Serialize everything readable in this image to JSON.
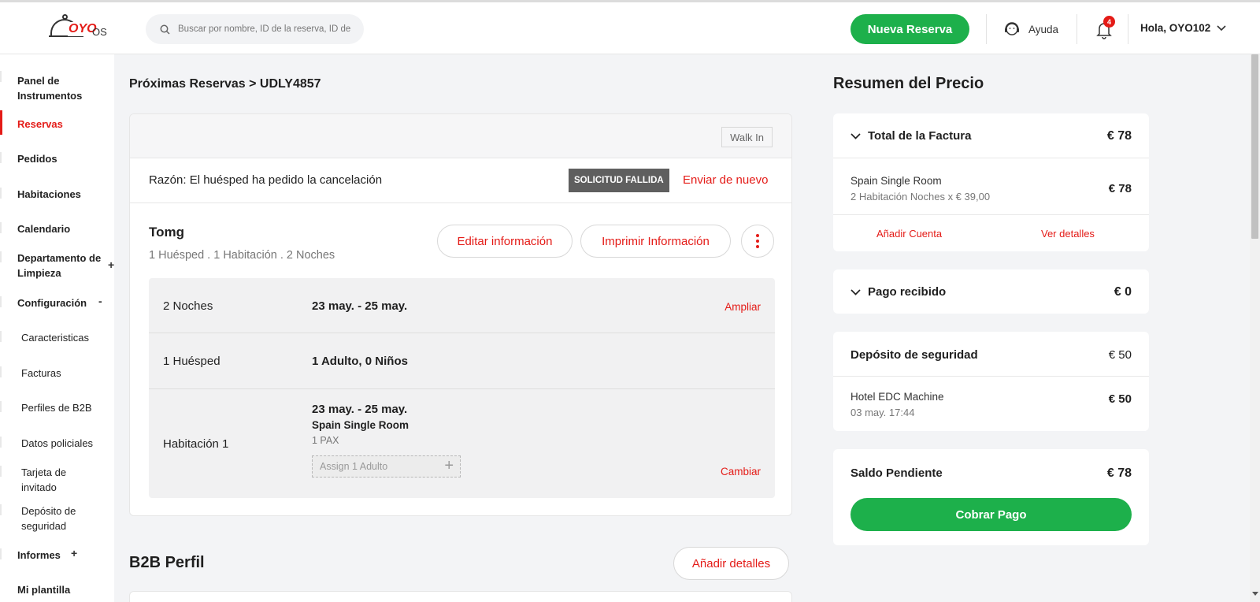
{
  "header": {
    "logo_brand": "OYO",
    "logo_suffix": "OS",
    "search_placeholder": "Buscar por nombre, ID de la reserva, ID de",
    "new_booking_label": "Nueva Reserva",
    "help_label": "Ayuda",
    "notification_count": "4",
    "user_greeting": "Hola, OYO102"
  },
  "sidebar": {
    "items": [
      {
        "label": "Panel de Instrumentos"
      },
      {
        "label": "Reservas"
      },
      {
        "label": "Pedidos"
      },
      {
        "label": "Habitaciones"
      },
      {
        "label": "Calendario"
      },
      {
        "label": "Departamento de Limpieza",
        "sign": "+"
      },
      {
        "label": "Configuración",
        "sign": "-"
      },
      {
        "label": "Caracteristicas"
      },
      {
        "label": "Facturas"
      },
      {
        "label": "Perfiles de B2B"
      },
      {
        "label": "Datos policiales"
      },
      {
        "label": "Tarjeta de invitado"
      },
      {
        "label": "Depósito de seguridad"
      },
      {
        "label": "Informes",
        "sign": "+"
      },
      {
        "label": "Mi plantilla"
      }
    ]
  },
  "main": {
    "breadcrumb": "Próximas Reservas > UDLY4857",
    "walk_in": "Walk In",
    "reason": "Razón: El huésped ha pedido la cancelación",
    "failed_badge": "SOLICITUD FALLIDA",
    "resend_link": "Enviar de nuevo",
    "guest_name": "Tomg",
    "guest_summary": "1 Huésped . 1 Habitación . 2 Noches",
    "edit_button": "Editar información",
    "print_button": "Imprimir Información",
    "details": {
      "nights_label": "2 Noches",
      "nights_value": "23 may. - 25 may.",
      "extend_link": "Ampliar",
      "guests_label": "1 Huésped",
      "guests_value": "1 Adulto, 0 Niños",
      "room_label": "Habitación 1",
      "room_dates": "23 may. - 25 may.",
      "room_type": "Spain Single Room",
      "room_pax": "1 PAX",
      "assign_placeholder": "Assign 1 Adulto",
      "change_link": "Cambiar"
    },
    "b2b_title": "B2B Perfil",
    "b2b_button": "Añadir detalles"
  },
  "summary": {
    "title": "Resumen del Precio",
    "invoice": {
      "label": "Total de la Factura",
      "amount": "€ 78",
      "line_title": "Spain Single Room",
      "line_detail": "2 Habitación Noches x € 39,00",
      "line_amount": "€ 78",
      "add_account": "Añadir Cuenta",
      "view_details": "Ver detalles"
    },
    "payment": {
      "label": "Pago recibido",
      "amount": "€ 0"
    },
    "deposit": {
      "label": "Depósito de seguridad",
      "amount": "€ 50",
      "line_title": "Hotel EDC Machine",
      "line_detail": "03 may. 17:44",
      "line_amount": "€ 50"
    },
    "balance": {
      "label": "Saldo Pendiente",
      "amount": "€ 78",
      "collect_button": "Cobrar Pago"
    }
  },
  "colors": {
    "accent_red": "#e41b17",
    "primary_green": "#1db04b"
  }
}
